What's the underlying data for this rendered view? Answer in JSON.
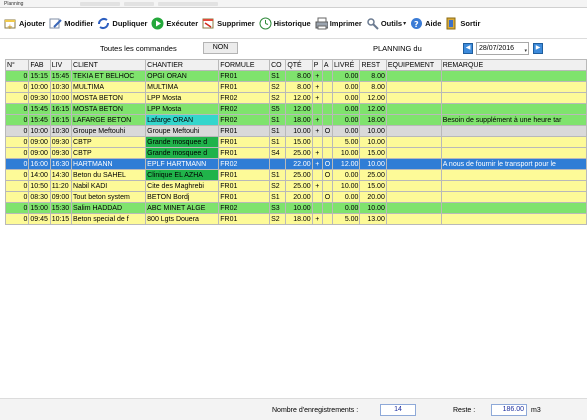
{
  "window": {
    "title": "Planning"
  },
  "toolbar": [
    {
      "label": "Ajouter",
      "icon": "add-row-icon"
    },
    {
      "label": "Modifier",
      "icon": "edit-icon"
    },
    {
      "label": "Dupliquer",
      "icon": "duplicate-icon"
    },
    {
      "label": "Exécuter",
      "icon": "execute-icon"
    },
    {
      "label": "Supprimer",
      "icon": "delete-icon"
    },
    {
      "label": "Historique",
      "icon": "history-icon"
    },
    {
      "label": "Imprimer",
      "icon": "printer-icon"
    },
    {
      "label": "Outils",
      "icon": "tools-icon"
    },
    {
      "label": "Aide",
      "icon": "help-icon"
    },
    {
      "label": "Sortir",
      "icon": "exit-icon"
    }
  ],
  "filter": {
    "all_orders_label": "Toutes les commandes",
    "non_button": "NON",
    "planning_label": "PLANNING du",
    "date": "28/07/2016"
  },
  "columns": [
    "N°",
    "FAB",
    "LIV",
    "CLIENT",
    "CHANTIER",
    "FORMULE",
    "CO",
    "QTÉ",
    "P",
    "A",
    "LIVRÉ",
    "REST",
    "EQUIPEMENT",
    "REMARQUE"
  ],
  "rows": [
    {
      "n": "0",
      "fab": "15:15",
      "liv": "15:45",
      "client": "TEKIA ET BELHOC",
      "chantier": "OPGI ORAN",
      "formule": "FR01",
      "co": "S1",
      "qte": "8.00",
      "p": "+",
      "a": "",
      "livre": "0.00",
      "rest": "8.00",
      "equip": "",
      "remarque": "",
      "row": "green",
      "chantier_color": ""
    },
    {
      "n": "0",
      "fab": "10:00",
      "liv": "10:30",
      "client": "MULTIMA",
      "chantier": "MULTIMA",
      "formule": "FR01",
      "co": "S2",
      "qte": "8.00",
      "p": "+",
      "a": "",
      "livre": "0.00",
      "rest": "8.00",
      "equip": "",
      "remarque": "",
      "row": "yellow",
      "chantier_color": ""
    },
    {
      "n": "0",
      "fab": "09:30",
      "liv": "10:00",
      "client": "MOSTA BETON",
      "chantier": "LPP Mosta",
      "formule": "FR02",
      "co": "S2",
      "qte": "12.00",
      "p": "+",
      "a": "",
      "livre": "0.00",
      "rest": "12.00",
      "equip": "",
      "remarque": "",
      "row": "yellow",
      "chantier_color": ""
    },
    {
      "n": "0",
      "fab": "15:45",
      "liv": "16:15",
      "client": "MOSTA BETON",
      "chantier": "LPP Mosta",
      "formule": "FR02",
      "co": "S5",
      "qte": "12.00",
      "p": "",
      "a": "",
      "livre": "0.00",
      "rest": "12.00",
      "equip": "",
      "remarque": "",
      "row": "green",
      "chantier_color": ""
    },
    {
      "n": "0",
      "fab": "15:45",
      "liv": "16:15",
      "client": "LAFARGE BETON",
      "chantier": "Lafarge ORAN",
      "formule": "FR02",
      "co": "S1",
      "qte": "18.00",
      "p": "+",
      "a": "",
      "livre": "0.00",
      "rest": "18.00",
      "equip": "",
      "remarque": "Besoin de supplément à une heure tar",
      "row": "green",
      "chantier_color": "cyan"
    },
    {
      "n": "0",
      "fab": "10:00",
      "liv": "10:30",
      "client": "Groupe Meftouhi",
      "chantier": "Groupe Meftouhi",
      "formule": "FR01",
      "co": "S1",
      "qte": "10.00",
      "p": "+",
      "a": "O",
      "livre": "0.00",
      "rest": "10.00",
      "equip": "",
      "remarque": "",
      "row": "gray",
      "chantier_color": ""
    },
    {
      "n": "0",
      "fab": "09:00",
      "liv": "09:30",
      "client": "CBTP",
      "chantier": "Grande mosquee d",
      "formule": "FR01",
      "co": "S1",
      "qte": "15.00",
      "p": "",
      "a": "",
      "livre": "5.00",
      "rest": "10.00",
      "equip": "",
      "remarque": "",
      "row": "yellow",
      "chantier_color": "dgreen"
    },
    {
      "n": "0",
      "fab": "09:00",
      "liv": "09:30",
      "client": "CBTP",
      "chantier": "Grande mosquee d",
      "formule": "FR01",
      "co": "S4",
      "qte": "25.00",
      "p": "+",
      "a": "",
      "livre": "10.00",
      "rest": "15.00",
      "equip": "",
      "remarque": "",
      "row": "yellow",
      "chantier_color": "dgreen"
    },
    {
      "n": "0",
      "fab": "16:00",
      "liv": "16:30",
      "client": "HARTMANN",
      "chantier": "EPLF HARTMANN",
      "formule": "FR02",
      "co": "",
      "qte": "22.00",
      "p": "+",
      "a": "O",
      "livre": "12.00",
      "rest": "10.00",
      "equip": "",
      "remarque": "A nous de fournir le transport pour le",
      "row": "sel",
      "chantier_color": ""
    },
    {
      "n": "0",
      "fab": "14:00",
      "liv": "14:30",
      "client": "Beton du SAHEL",
      "chantier": "Clinique EL AZHA",
      "formule": "FR01",
      "co": "S1",
      "qte": "25.00",
      "p": "",
      "a": "O",
      "livre": "0.00",
      "rest": "25.00",
      "equip": "",
      "remarque": "",
      "row": "yellow",
      "chantier_color": "dgreen"
    },
    {
      "n": "0",
      "fab": "10:50",
      "liv": "11:20",
      "client": "Nabil KADI",
      "chantier": "Cite des Maghrebi",
      "formule": "FR01",
      "co": "S2",
      "qte": "25.00",
      "p": "+",
      "a": "",
      "livre": "10.00",
      "rest": "15.00",
      "equip": "",
      "remarque": "",
      "row": "yellow",
      "chantier_color": ""
    },
    {
      "n": "0",
      "fab": "08:30",
      "liv": "09:00",
      "client": "Tout beton system",
      "chantier": "BETON Bordj",
      "formule": "FR01",
      "co": "S1",
      "qte": "20.00",
      "p": "",
      "a": "O",
      "livre": "0.00",
      "rest": "20.00",
      "equip": "",
      "remarque": "",
      "row": "yellow",
      "chantier_color": ""
    },
    {
      "n": "0",
      "fab": "15:00",
      "liv": "15:30",
      "client": "Salim HADDAD",
      "chantier": "ABC MINET ALGE",
      "formule": "FR02",
      "co": "S3",
      "qte": "10.00",
      "p": "",
      "a": "",
      "livre": "0.00",
      "rest": "10.00",
      "equip": "",
      "remarque": "",
      "row": "green",
      "chantier_color": ""
    },
    {
      "n": "0",
      "fab": "09:45",
      "liv": "10:15",
      "client": "Beton special de f",
      "chantier": "800 Lgts Douera",
      "formule": "FR01",
      "co": "S2",
      "qte": "18.00",
      "p": "+",
      "a": "",
      "livre": "5.00",
      "rest": "13.00",
      "equip": "",
      "remarque": "",
      "row": "yellow",
      "chantier_color": ""
    }
  ],
  "footer": {
    "records_label": "Nombre d'enregistrements :",
    "records_count": "14",
    "rest_label": "Reste :",
    "rest_value": "186.00",
    "unit": "m3"
  },
  "colors": {
    "green_row": "#7fe36d",
    "yellow_row": "#fdfa98",
    "gray_row": "#d9d9d9",
    "selected_row": "#2f7dd6",
    "cyan_cell": "#34d6cc",
    "dark_green_cell": "#20b34a"
  }
}
